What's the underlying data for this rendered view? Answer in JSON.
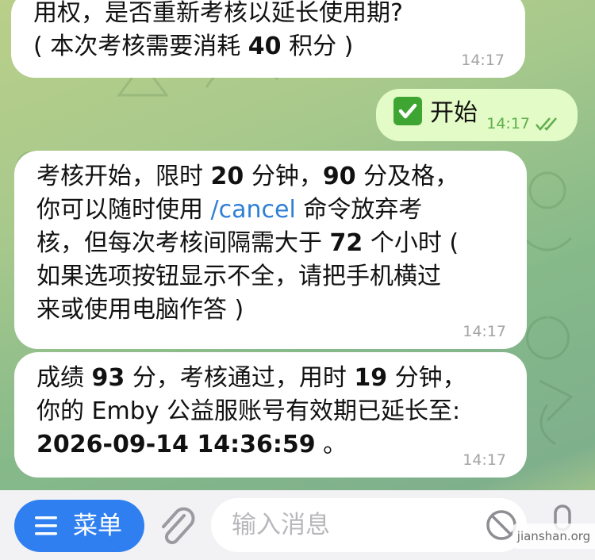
{
  "messages": [
    {
      "id": "b1",
      "direction": "incoming",
      "lines": [
        "用权，是否重新考核以延长使用期?",
        "( 本次考核需要消耗 40 积分 )"
      ],
      "time": "14:17"
    },
    {
      "id": "b2",
      "direction": "outgoing",
      "emoji_icon": "check-mark-button-icon",
      "text": "开始",
      "time": "14:17",
      "status_icon": "double-check-read-icon"
    },
    {
      "id": "b3",
      "direction": "incoming",
      "line1_a": "考核开始，限时 ",
      "line1_b": "20",
      "line1_c": " 分钟，",
      "line1_d": "90",
      "line1_e": " 分及格，",
      "line2_a": "你可以随时使用 ",
      "line2_cmd": "/cancel",
      "line2_b": " 命令放弃考",
      "line3_a": "核，但每次考核间隔需大于 ",
      "line3_b": "72",
      "line3_c": " 个小时 (",
      "line4": "如果选项按钮显示不全，请把手机横过",
      "line5": "来或使用电脑作答 )",
      "time": "14:17"
    },
    {
      "id": "b4",
      "direction": "incoming",
      "line1_a": "成绩 ",
      "line1_b": "93",
      "line1_c": " 分，考核通过，用时 ",
      "line1_d": "19",
      "line1_e": " 分钟，",
      "line2": "你的 Emby 公益服账号有效期已延长至:",
      "line3_a": "2026-09-14 14:36:59",
      "line3_b": " 。",
      "time": "14:17"
    }
  ],
  "bottom_bar": {
    "menu_label": "菜单",
    "menu_icon": "hamburger-icon",
    "attach_icon": "paperclip-icon",
    "input_placeholder": "输入消息",
    "sticker_icon": "sticker-icon",
    "mic_icon": "microphone-icon"
  },
  "watermark": "jianshan.org",
  "colors": {
    "incoming_bubble": "#ffffff",
    "outgoing_bubble": "#e3fbc6",
    "link": "#2f7fd6",
    "menu_button": "#2f7ff1",
    "outgoing_time": "#5fae4e"
  }
}
